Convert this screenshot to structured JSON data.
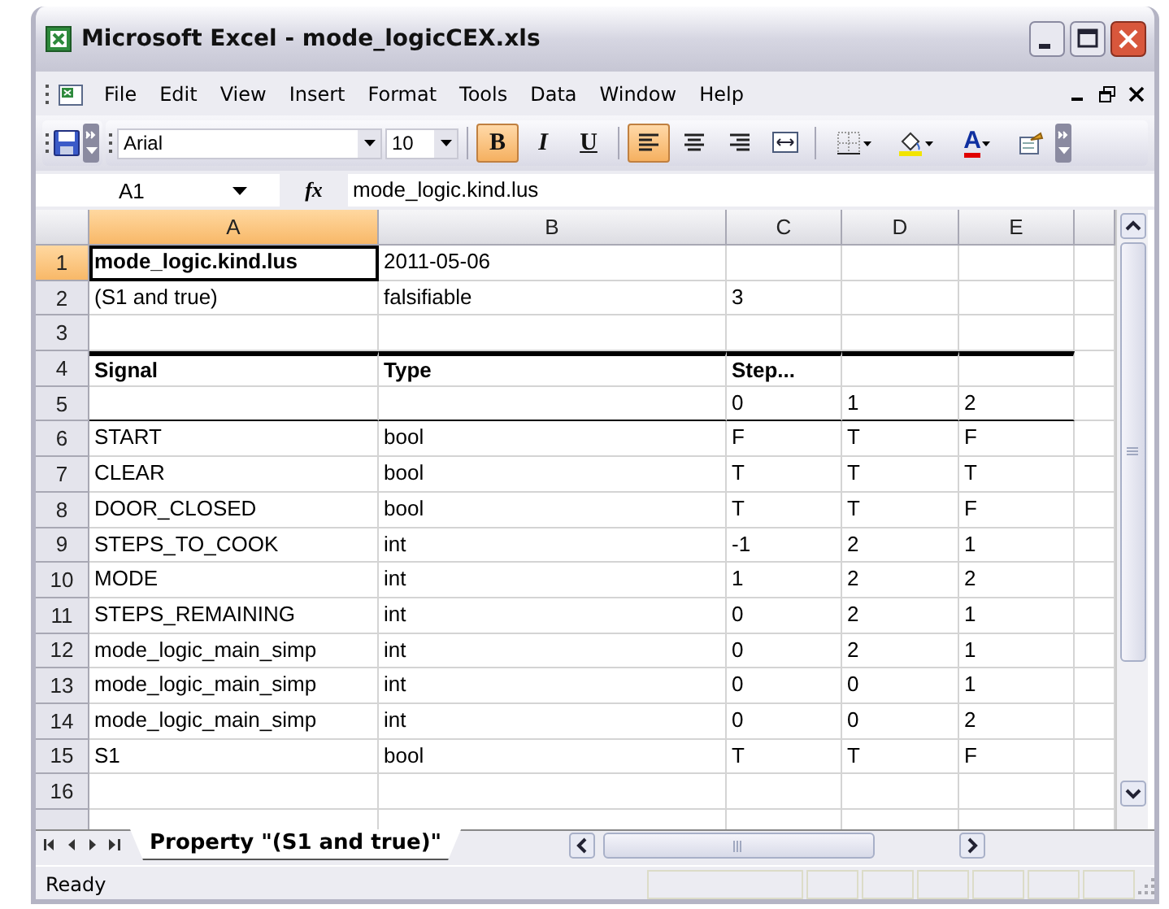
{
  "window": {
    "title": "Microsoft Excel - mode_logicCEX.xls"
  },
  "menu": [
    "File",
    "Edit",
    "View",
    "Insert",
    "Format",
    "Tools",
    "Data",
    "Window",
    "Help"
  ],
  "toolbar": {
    "font": "Arial",
    "size": "10",
    "buttons": [
      {
        "kind": "bold",
        "label": "B",
        "on": true
      },
      {
        "kind": "italic",
        "label": "I",
        "on": false
      },
      {
        "kind": "underline",
        "label": "U",
        "on": false
      },
      {
        "kind": "align-left",
        "on": true
      },
      {
        "kind": "center",
        "on": false
      },
      {
        "kind": "align-right",
        "on": false
      },
      {
        "kind": "merge",
        "on": false
      },
      {
        "kind": "borders",
        "on": false
      },
      {
        "kind": "fill-color",
        "on": false
      },
      {
        "kind": "font-color",
        "label": "A",
        "on": false
      },
      {
        "kind": "research",
        "on": false
      }
    ]
  },
  "formula_bar": {
    "name_box": "A1",
    "function_label": "fx",
    "content": "mode_logic.kind.lus"
  },
  "sheet": {
    "columns": [
      {
        "label": "A",
        "selected": true
      },
      {
        "label": "B",
        "selected": false
      },
      {
        "label": "C",
        "selected": false
      },
      {
        "label": "D",
        "selected": false
      },
      {
        "label": "E",
        "selected": false
      }
    ],
    "rows": [
      {
        "number": "1",
        "selected": true,
        "kind": "title",
        "cells": [
          "mode_logic.kind.lus",
          "2011-05-06",
          "",
          "",
          ""
        ]
      },
      {
        "number": "2",
        "selected": false,
        "kind": "data",
        "cells": [
          "(S1 and true)",
          "falsifiable",
          "3",
          "",
          ""
        ]
      },
      {
        "number": "3",
        "selected": false,
        "kind": "data",
        "cells": [
          "",
          "",
          "",
          "",
          ""
        ]
      },
      {
        "number": "4",
        "selected": false,
        "kind": "header",
        "cells": [
          "Signal",
          "Type",
          "Step...",
          "",
          ""
        ]
      },
      {
        "number": "5",
        "selected": false,
        "kind": "steps",
        "cells": [
          "",
          "",
          "0",
          "1",
          "2"
        ]
      },
      {
        "number": "6",
        "selected": false,
        "kind": "data",
        "cells": [
          "START",
          "bool",
          "F",
          "T",
          "F"
        ]
      },
      {
        "number": "7",
        "selected": false,
        "kind": "data",
        "cells": [
          "CLEAR",
          "bool",
          "T",
          "T",
          "T"
        ]
      },
      {
        "number": "8",
        "selected": false,
        "kind": "data",
        "cells": [
          "DOOR_CLOSED",
          "bool",
          "T",
          "T",
          "F"
        ]
      },
      {
        "number": "9",
        "selected": false,
        "kind": "data",
        "cells": [
          "STEPS_TO_COOK",
          "int",
          "-1",
          "2",
          "1"
        ]
      },
      {
        "number": "10",
        "selected": false,
        "kind": "data",
        "cells": [
          "MODE",
          "int",
          "1",
          "2",
          "2"
        ]
      },
      {
        "number": "11",
        "selected": false,
        "kind": "data",
        "cells": [
          "STEPS_REMAINING",
          "int",
          "0",
          "2",
          "1"
        ]
      },
      {
        "number": "12",
        "selected": false,
        "kind": "data",
        "cells": [
          "mode_logic_main_simp",
          "int",
          "0",
          "2",
          "1"
        ]
      },
      {
        "number": "13",
        "selected": false,
        "kind": "data",
        "cells": [
          "mode_logic_main_simp",
          "int",
          "0",
          "0",
          "1"
        ]
      },
      {
        "number": "14",
        "selected": false,
        "kind": "data",
        "cells": [
          "mode_logic_main_simp",
          "int",
          "0",
          "0",
          "2"
        ]
      },
      {
        "number": "15",
        "selected": false,
        "kind": "data",
        "cells": [
          "S1",
          "bool",
          "T",
          "T",
          "F"
        ]
      },
      {
        "number": "16",
        "selected": false,
        "kind": "data",
        "cells": [
          "",
          "",
          "",
          "",
          ""
        ]
      }
    ]
  },
  "sheet_tabs": [
    {
      "label": "Property \"(S1 and true)\"",
      "selected": true
    }
  ],
  "status_bar": {
    "text": "Ready"
  }
}
